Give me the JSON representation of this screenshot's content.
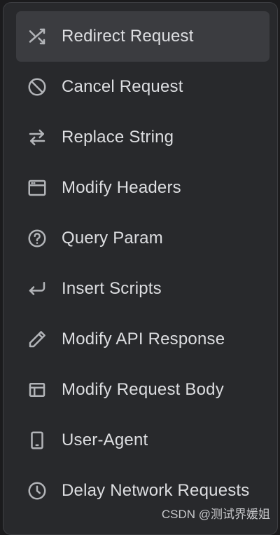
{
  "menu": {
    "items": [
      {
        "label": "Redirect Request",
        "icon": "shuffle-icon",
        "active": true
      },
      {
        "label": "Cancel Request",
        "icon": "block-icon",
        "active": false
      },
      {
        "label": "Replace String",
        "icon": "swap-arrows-icon",
        "active": false
      },
      {
        "label": "Modify Headers",
        "icon": "browser-window-icon",
        "active": false
      },
      {
        "label": "Query Param",
        "icon": "help-circle-icon",
        "active": false
      },
      {
        "label": "Insert Scripts",
        "icon": "return-arrow-icon",
        "active": false
      },
      {
        "label": "Modify API Response",
        "icon": "pencil-icon",
        "active": false
      },
      {
        "label": "Modify Request Body",
        "icon": "layout-icon",
        "active": false
      },
      {
        "label": "User-Agent",
        "icon": "tablet-icon",
        "active": false
      },
      {
        "label": "Delay Network Requests",
        "icon": "clock-icon",
        "active": false
      }
    ]
  },
  "watermark": "CSDN @测试界媛姐",
  "colors": {
    "menu_background": "#28292c",
    "active_item_background": "#3b3c40",
    "label_text": "#dddee1",
    "icon_stroke": "#b2b4b8"
  }
}
